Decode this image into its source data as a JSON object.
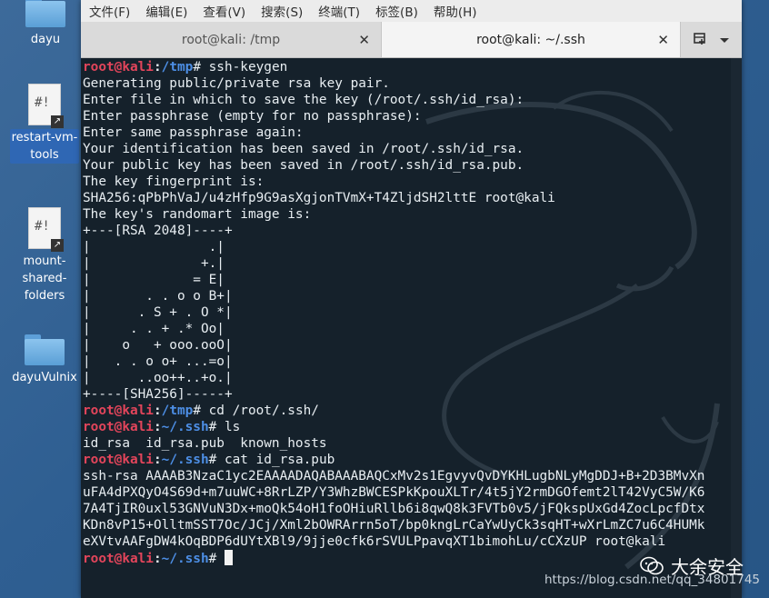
{
  "desktop": {
    "icons": [
      {
        "label": "dayu",
        "type": "folder"
      },
      {
        "label": "restart-vm-tools",
        "type": "script",
        "label_lines": [
          "restart-vm-",
          "tools"
        ]
      },
      {
        "label": "mount-shared-folders",
        "type": "script",
        "label_lines": [
          "mount-",
          "shared-",
          "folders"
        ]
      },
      {
        "label": "dayuVulnix",
        "type": "folder"
      }
    ]
  },
  "menubar": {
    "items": [
      "文件(F)",
      "编辑(E)",
      "查看(V)",
      "搜索(S)",
      "终端(T)",
      "标签(B)",
      "帮助(H)"
    ]
  },
  "tabs": [
    {
      "title": "root@kali: /tmp",
      "active": false
    },
    {
      "title": "root@kali: ~/.ssh",
      "active": true
    }
  ],
  "terminal": {
    "prompt_user": "root@kali",
    "lines": [
      {
        "prompt": true,
        "path": "/tmp",
        "cmd": " ssh-keygen"
      },
      {
        "text": "Generating public/private rsa key pair."
      },
      {
        "text": "Enter file in which to save the key (/root/.ssh/id_rsa):"
      },
      {
        "text": "Enter passphrase (empty for no passphrase):"
      },
      {
        "text": "Enter same passphrase again:"
      },
      {
        "text": "Your identification has been saved in /root/.ssh/id_rsa."
      },
      {
        "text": "Your public key has been saved in /root/.ssh/id_rsa.pub."
      },
      {
        "text": "The key fingerprint is:"
      },
      {
        "text": "SHA256:qPbPhVaJ/u4zHfp9G9asXgjonTVmX+T4ZljdSH2lttE root@kali"
      },
      {
        "text": "The key's randomart image is:"
      },
      {
        "text": "+---[RSA 2048]----+"
      },
      {
        "text": "|               .|"
      },
      {
        "text": "|              +.|"
      },
      {
        "text": "|             = E|"
      },
      {
        "text": "|       . . o o B+|"
      },
      {
        "text": "|      . S + . O *|"
      },
      {
        "text": "|     . . + .* Oo|"
      },
      {
        "text": "|    o   + ooo.ooO|"
      },
      {
        "text": "|   . . o o+ ...=o|"
      },
      {
        "text": "|      ..oo++..+o.|"
      },
      {
        "text": "+----[SHA256]-----+"
      },
      {
        "prompt": true,
        "path": "/tmp",
        "cmd": " cd /root/.ssh/"
      },
      {
        "prompt": true,
        "path": "~/.ssh",
        "cmd": " ls"
      },
      {
        "text": "id_rsa  id_rsa.pub  known_hosts"
      },
      {
        "prompt": true,
        "path": "~/.ssh",
        "cmd": " cat id_rsa.pub"
      },
      {
        "text": "ssh-rsa AAAAB3NzaC1yc2EAAAADAQABAAABAQCxMv2s1EgvyvQvDYKHLugbNLyMgDDJ+B+2D3BMvXn"
      },
      {
        "text": "uFA4dPXQyO4S69d+m7uuWC+8RrLZP/Y3WhzBWCESPkKpouXLTr/4t5jY2rmDGOfemt2lT42VyC5W/K6"
      },
      {
        "text": "7A4TjIR0uxl53GNVuN3Dx+moQk54oH1foOHiuRllb6i8qwQ8k3FVTb0v5/jFQkspUxGd4ZocLpcfDtx"
      },
      {
        "text": "KDn8vP15+OlltmSST7Oc/JCj/Xml2bOWRArrn5oT/bp0kngLrCaYwUyCk3sqHT+wXrLmZC7u6C4HUMk"
      },
      {
        "text": "eXVtvAAFgDW4kOqBDP6dUYtXBl9/9jje0cfk6rSVULPpavqXT1bimohLu/cCXzUP root@kali"
      },
      {
        "prompt": true,
        "path": "~/.ssh",
        "cmd": " ",
        "cursor": true
      }
    ]
  },
  "watermark": {
    "brand": "大余安全",
    "url": "https://blog.csdn.net/qq_34801745"
  },
  "icons": {
    "tab_close": "close-icon",
    "new_tab": "new-tab-icon",
    "tab_menu": "chevron-down-icon"
  }
}
